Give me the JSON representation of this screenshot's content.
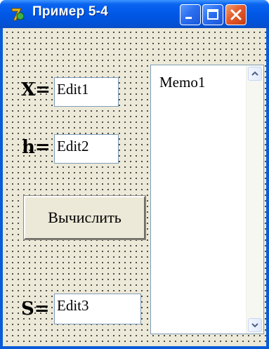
{
  "window": {
    "title": "Пример 5-4",
    "icon": "delphi-app-icon",
    "controls": [
      "minimize-icon",
      "maximize-icon",
      "close-icon"
    ]
  },
  "form": {
    "x_label": "X=",
    "x_value": "Edit1",
    "h_label": "h=",
    "h_value": "Edit2",
    "calc_button": "Вычислить",
    "s_label": "S=",
    "s_value": "Edit3"
  },
  "memo": {
    "text": "Memo1"
  },
  "colors": {
    "titlebar": "#0058e6",
    "client_bg": "#ece9d8",
    "close_button": "#e45a2c",
    "edit_border": "#7f9db9"
  }
}
